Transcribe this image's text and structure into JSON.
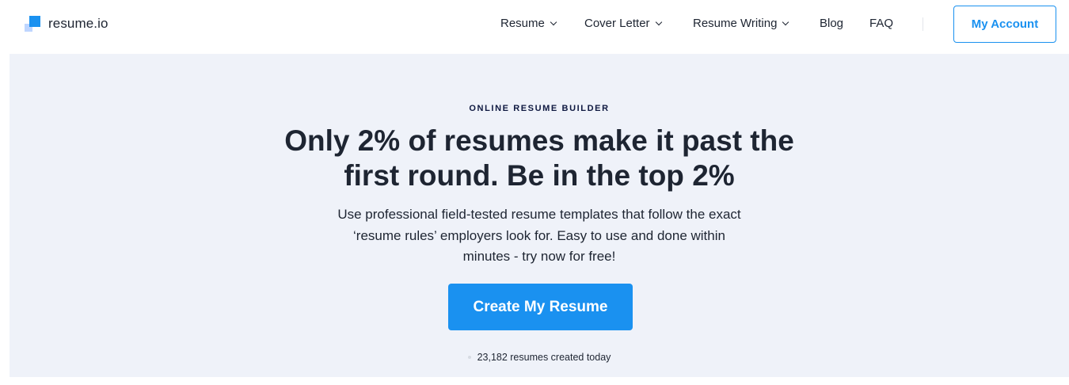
{
  "brand": {
    "name": "resume.io"
  },
  "nav": {
    "items": [
      {
        "label": "Resume",
        "has_dropdown": true
      },
      {
        "label": "Cover Letter",
        "has_dropdown": true
      },
      {
        "label": "Resume Writing",
        "has_dropdown": true
      },
      {
        "label": "Blog",
        "has_dropdown": false
      },
      {
        "label": "FAQ",
        "has_dropdown": false
      }
    ],
    "account_label": "My Account"
  },
  "hero": {
    "eyebrow": "ONLINE RESUME BUILDER",
    "headline_line1": "Only 2% of resumes make it past the",
    "headline_line2": "first round. Be in the top 2%",
    "subtext_line1": "Use professional field-tested resume templates that follow the exact",
    "subtext_line2": "‘resume rules’ employers look for. Easy to use and done within",
    "subtext_line3": "minutes - try now for free!",
    "cta_label": "Create My Resume",
    "counter_text": "23,182 resumes created today"
  },
  "colors": {
    "accent": "#1a91f0",
    "hero_background": "#eff2f9",
    "text": "#1e2532",
    "eyebrow": "#0f1941"
  },
  "icons": [
    "resume-io-logo-icon",
    "chevron-down-icon"
  ]
}
